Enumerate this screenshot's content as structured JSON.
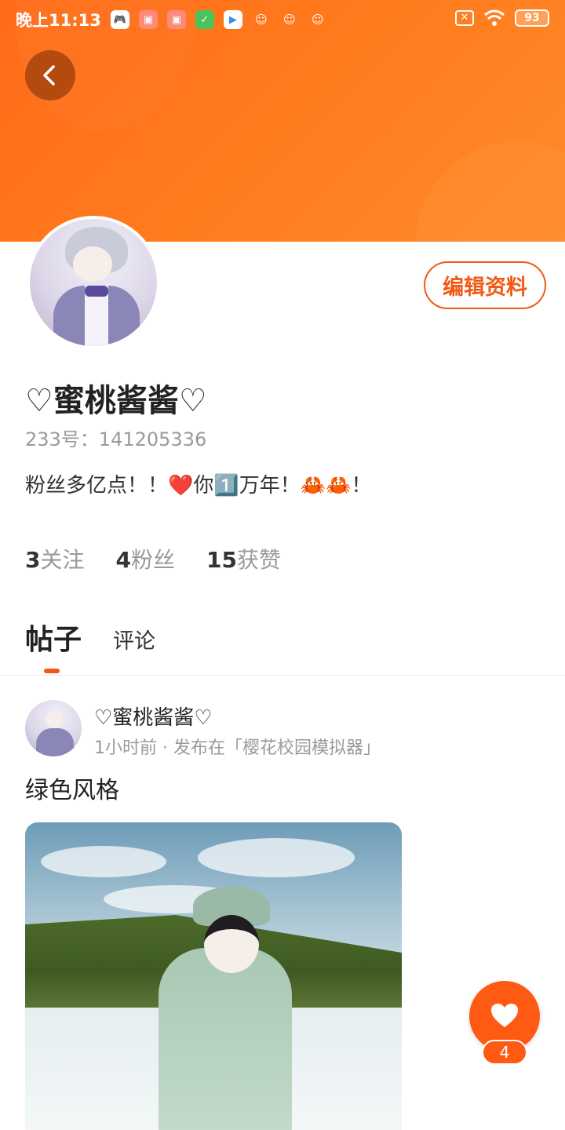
{
  "status_bar": {
    "time": "晚上11:13",
    "battery": "93",
    "apps": [
      "game-icon",
      "gift-icon",
      "gift-icon",
      "wechat-icon",
      "play-store-icon",
      "mascot-icon",
      "mascot-icon",
      "mascot-icon"
    ]
  },
  "profile": {
    "username": "♡蜜桃酱酱♡",
    "id_label": "233号：141205336",
    "bio": "粉丝多亿点！！❤️你1️⃣万年！🦀🦀！",
    "edit_label": "编辑资料"
  },
  "stats": [
    {
      "num": "3",
      "label": "关注"
    },
    {
      "num": "4",
      "label": "粉丝"
    },
    {
      "num": "15",
      "label": "获赞"
    }
  ],
  "tabs": {
    "active": "帖子",
    "other": "评论"
  },
  "post": {
    "author": "♡蜜桃酱酱♡",
    "meta": "1小时前 · 发布在「樱花校园模拟器」",
    "title": "绿色风格"
  },
  "like": {
    "count": "4"
  },
  "colors": {
    "accent": "#f05a14",
    "header": "#ff7a1c"
  }
}
